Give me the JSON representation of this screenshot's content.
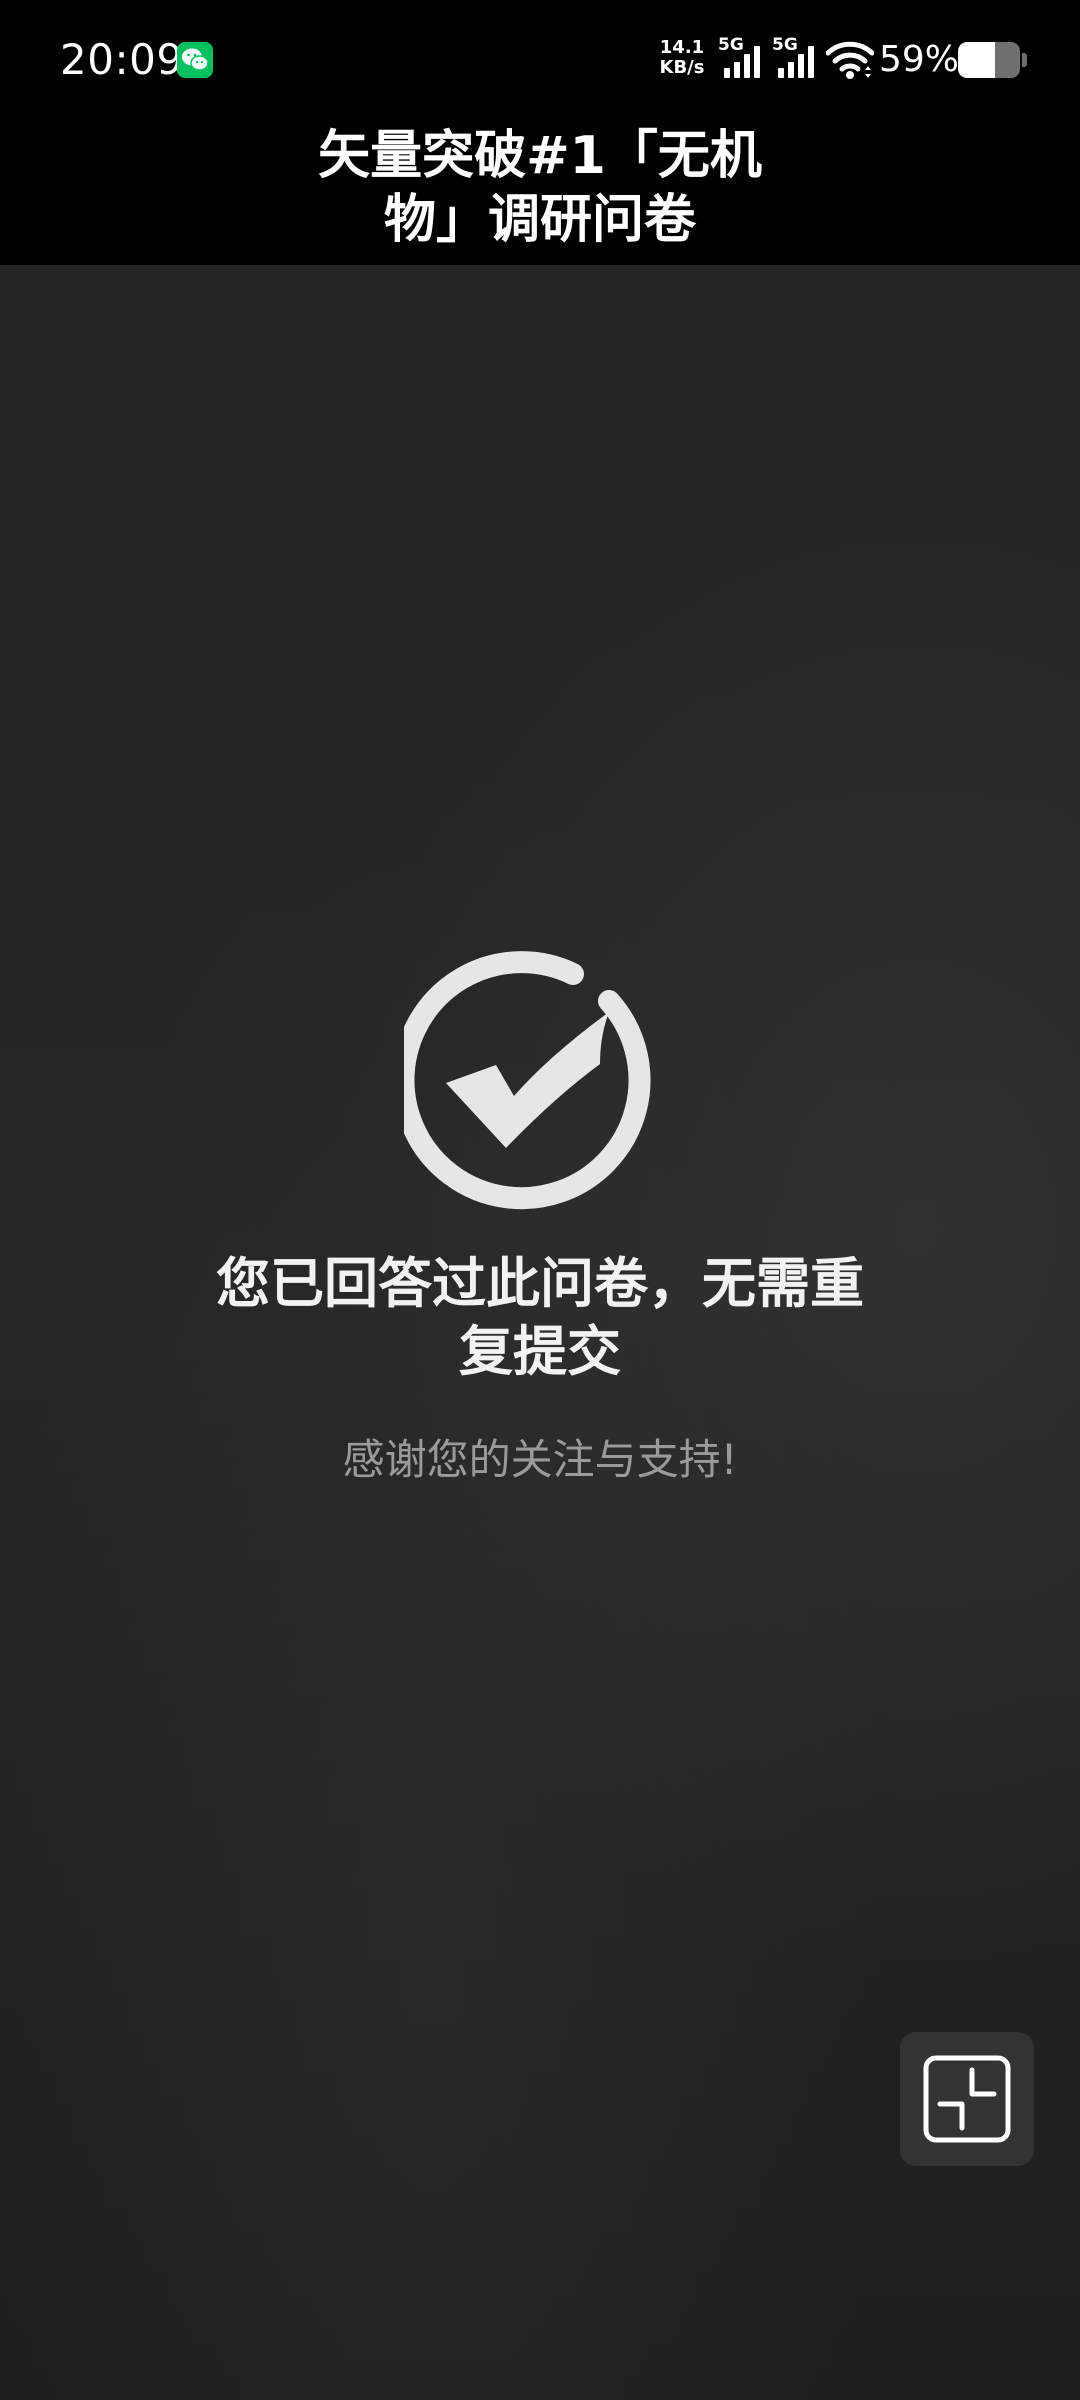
{
  "status_bar": {
    "time": "20:09",
    "net_speed_value": "14.1",
    "net_speed_unit": "KB/s",
    "signal_1_label": "5G",
    "signal_2_label": "5G",
    "battery_percent_label": "59%",
    "battery_level": 0.59,
    "icons": [
      "wechat-icon",
      "signal-icon",
      "wifi-icon",
      "battery-icon"
    ]
  },
  "header": {
    "title": "矢量突破#1「无机物」调研问卷"
  },
  "main": {
    "success_message": "您已回答过此问卷，无需重复提交",
    "thanks_text": "感谢您的关注与支持!",
    "success_icon": "check-circle-icon"
  },
  "floating_button": {
    "icon": "minimize-window-icon"
  },
  "colors": {
    "status_bar_bg": "#000000",
    "content_bg": "#242424",
    "icon_color": "#e6e6e6",
    "wechat_green": "#07c160",
    "secondary_text": "#9a9a9a"
  }
}
